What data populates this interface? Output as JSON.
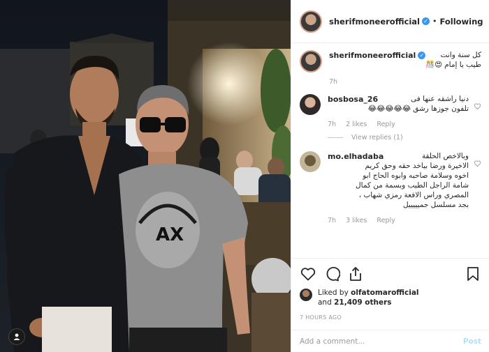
{
  "post": {
    "username": "sherifmoneerofficial",
    "follow_status": "Following",
    "dot": "•",
    "caption_line1": "كل سنة وانت",
    "caption_line2": "طيب يا إمام",
    "caption_emoji": "😍🎊",
    "caption_time": "7h"
  },
  "comments": [
    {
      "username": "bosbosa_26",
      "text_prefix": "دنيا راشقه عنها فى",
      "text_line2": "تلفون جوزها رشق",
      "emoji": "😂😂😂😂😂",
      "time": "7h",
      "likes": "2 likes",
      "reply": "Reply",
      "view_replies": "View replies (1)"
    },
    {
      "username": "mo.elhadaba",
      "text_line1": "وبالاخص الحلقة",
      "text_line2": "الاخيرة ورضا بياخد حقه وحق كريم",
      "text_line3": "اخوه وسلامة صاحبه وابوه الحاج ابو",
      "text_line4": "شامة الراجل الطيب وبسمة من كمال",
      "text_line5": "المصري وراس الافعة رمزي شهاب ،",
      "text_line6": "بجد مسلسل جميييييل",
      "time": "7h",
      "likes": "3 likes",
      "reply": "Reply"
    }
  ],
  "likes": {
    "liked_by": "Liked by",
    "user": "olfatomarofficial",
    "and": "and",
    "count": "21,409 others"
  },
  "time_ago": "7 HOURS AGO",
  "add_comment": {
    "placeholder": "Add a comment...",
    "post_label": "Post"
  },
  "icons": {
    "heart": "heart-icon",
    "comment": "comment-icon",
    "share": "share-icon",
    "bookmark": "bookmark-icon",
    "verified": "verified-badge-icon",
    "user_tag": "user-tag-icon"
  },
  "colors": {
    "verified": "#3897f0",
    "secondary_text": "#999999",
    "post_disabled": "#b2dffc"
  }
}
